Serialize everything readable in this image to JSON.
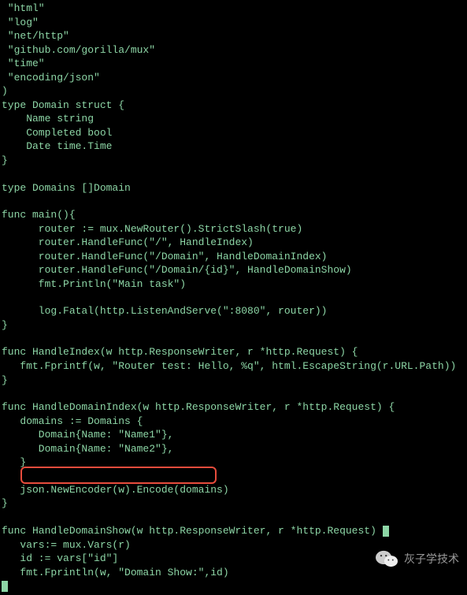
{
  "code": {
    "lines": [
      " \"html\"",
      " \"log\"",
      " \"net/http\"",
      " \"github.com/gorilla/mux\"",
      " \"time\"",
      " \"encoding/json\"",
      ")",
      "type Domain struct {",
      "    Name string",
      "    Completed bool",
      "    Date time.Time",
      "}",
      "",
      "type Domains []Domain",
      "",
      "func main(){",
      "      router := mux.NewRouter().StrictSlash(true)",
      "      router.HandleFunc(\"/\", HandleIndex)",
      "      router.HandleFunc(\"/Domain\", HandleDomainIndex)",
      "      router.HandleFunc(\"/Domain/{id}\", HandleDomainShow)",
      "      fmt.Println(\"Main task\")",
      "",
      "      log.Fatal(http.ListenAndServe(\":8080\", router))",
      "}",
      "",
      "func HandleIndex(w http.ResponseWriter, r *http.Request) {",
      "   fmt.Fprintf(w, \"Router test: Hello, %q\", html.EscapeString(r.URL.Path))",
      "}",
      "",
      "func HandleDomainIndex(w http.ResponseWriter, r *http.Request) {",
      "   domains := Domains {",
      "      Domain{Name: \"Name1\"},",
      "      Domain{Name: \"Name2\"},",
      "   }",
      "",
      "   json.NewEncoder(w).Encode(domains)",
      "}",
      "",
      "func HandleDomainShow(w http.ResponseWriter, r *http.Request) ",
      "   vars:= mux.Vars(r)",
      "   id := vars[\"id\"]",
      "   fmt.Fprintln(w, \"Domain Show:\",id)"
    ]
  },
  "footer": {
    "text": "灰子学技术"
  }
}
